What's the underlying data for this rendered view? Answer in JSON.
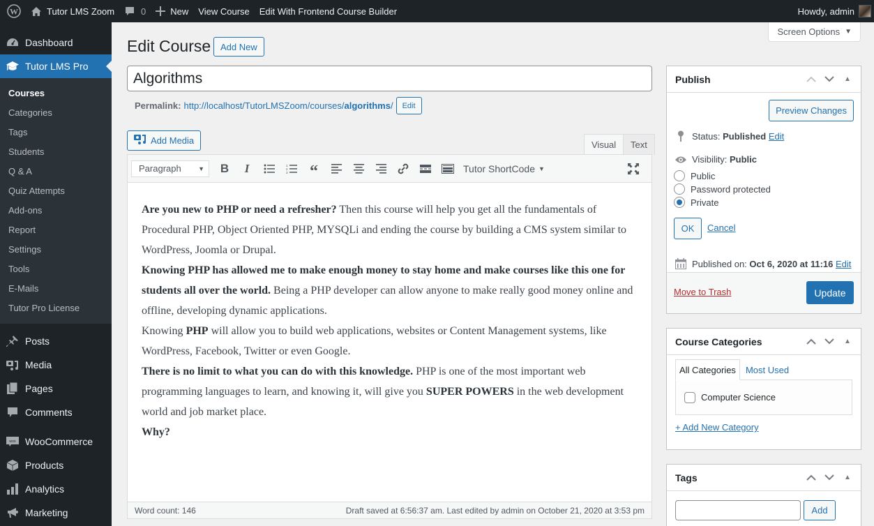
{
  "adminbar": {
    "site_name": "Tutor LMS Zoom",
    "comments_count": "0",
    "new_label": "New",
    "view_course": "View Course",
    "edit_frontend": "Edit With Frontend Course Builder",
    "howdy": "Howdy, admin"
  },
  "sidebar": {
    "dashboard": "Dashboard",
    "current_menu": "Tutor LMS Pro",
    "submenu": [
      "Courses",
      "Categories",
      "Tags",
      "Students",
      "Q & A",
      "Quiz Attempts",
      "Add-ons",
      "Report",
      "Settings",
      "Tools",
      "E-Mails",
      "Tutor Pro License"
    ],
    "items": [
      "Posts",
      "Media",
      "Pages",
      "Comments",
      "WooCommerce",
      "Products",
      "Analytics",
      "Marketing"
    ]
  },
  "screen_options": "Screen Options",
  "page": {
    "title": "Edit Course",
    "add_new": "Add New",
    "course_title": "Algorithms",
    "permalink_label": "Permalink:",
    "permalink_base": "http://localhost/TutorLMSZoom/courses/",
    "permalink_slug": "algorithms",
    "permalink_end": "/",
    "permalink_edit": "Edit"
  },
  "editor": {
    "add_media": "Add Media",
    "tab_visual": "Visual",
    "tab_text": "Text",
    "format": "Paragraph",
    "shortcode": "Tutor ShortCode",
    "content": {
      "p1_bold": "Are you new to PHP or need a refresher?",
      "p1_rest": " Then this course will help you get all the fundamentals of Procedural PHP, Object Oriented PHP, MYSQLi and ending the course by building a CMS system similar to WordPress, Joomla or Drupal.",
      "p2_bold": "Knowing PHP has allowed me to make enough money to stay home and make courses like this one for students all over the world.",
      "p2_rest": " Being a PHP developer can allow anyone to make really good money online and offline, developing dynamic applications.",
      "p3_a": "Knowing ",
      "p3_bold": "PHP",
      "p3_b": " will allow you to build web applications, websites or Content Management systems, like WordPress, Facebook, Twitter or even Google.",
      "p4_bold": "There is no limit to what you can do with this knowledge.",
      "p4_a": " PHP is one of the most important web programming languages to learn, and knowing it, will give you ",
      "p4_bold2": "SUPER POWERS",
      "p4_b": " in the web development world and job market place.",
      "p5_bold": "Why?"
    },
    "word_count": "Word count: 146",
    "draft_status": "Draft saved at 6:56:37 am. Last edited by admin on October 21, 2020 at 3:53 pm"
  },
  "publish": {
    "title": "Publish",
    "preview": "Preview Changes",
    "status_label": "Status:",
    "status_value": "Published",
    "edit": "Edit",
    "visibility_label": "Visibility:",
    "visibility_value": "Public",
    "options": [
      "Public",
      "Password protected",
      "Private"
    ],
    "selected": "Private",
    "ok": "OK",
    "cancel": "Cancel",
    "published_label": "Published on:",
    "published_value": "Oct 6, 2020 at 11:16",
    "trash": "Move to Trash",
    "update": "Update"
  },
  "categories": {
    "title": "Course Categories",
    "tab_all": "All Categories",
    "tab_most": "Most Used",
    "items": [
      "Computer Science"
    ],
    "add_new": "+ Add New Category"
  },
  "tags": {
    "title": "Tags",
    "input_value": "",
    "add": "Add"
  },
  "colors": {
    "admin_bar": "#1d2327",
    "accent": "#2271b1",
    "trash": "#b32d2e"
  }
}
